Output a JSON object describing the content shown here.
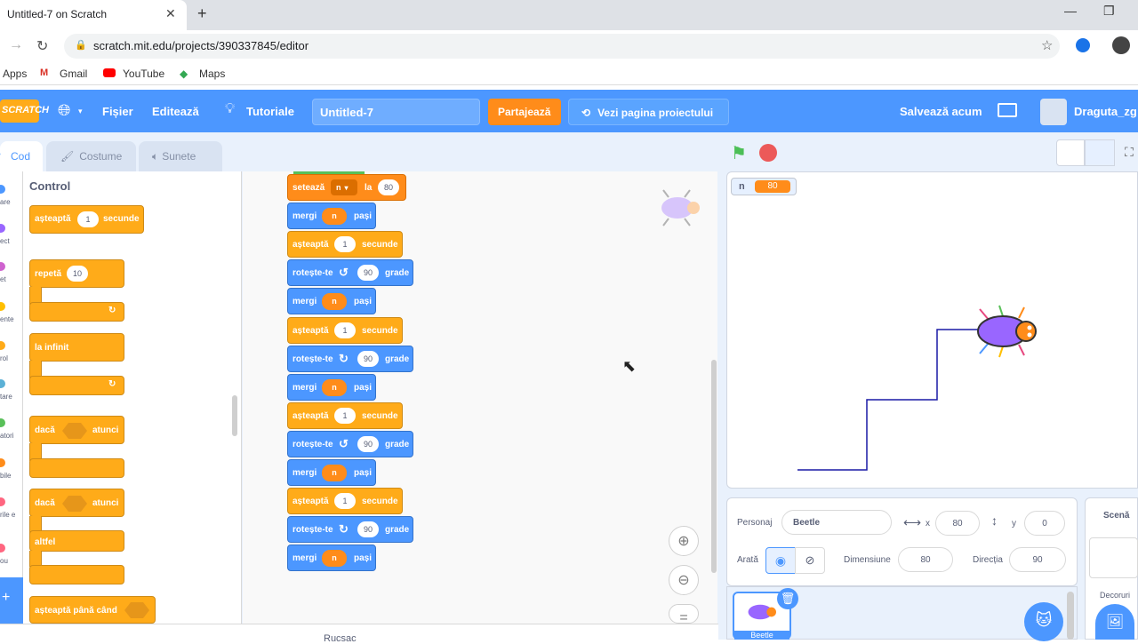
{
  "browser": {
    "tab_title": "Untitled-7 on Scratch",
    "url": "scratch.mit.edu/projects/390337845/editor",
    "bookmarks": [
      "Apps",
      "Gmail",
      "YouTube",
      "Maps"
    ]
  },
  "menu": {
    "logo": "SCRATCH",
    "file": "Fișier",
    "edit": "Editează",
    "tutorials": "Tutoriale",
    "project_title": "Untitled-7",
    "share": "Partajează",
    "see_project": "Vezi pagina proiectului",
    "save_now": "Salvează acum",
    "username": "Draguta_zg"
  },
  "tabs": {
    "code": "Cod",
    "costumes": "Costume",
    "sounds": "Sunete"
  },
  "categories": [
    {
      "label": "are",
      "color": "#4c97ff"
    },
    {
      "label": "ect",
      "color": "#9966ff"
    },
    {
      "label": "et",
      "color": "#cf63cf"
    },
    {
      "label": "ente",
      "color": "#ffbf00"
    },
    {
      "label": "rol",
      "color": "#ffab19"
    },
    {
      "label": "tare",
      "color": "#5cb1d6"
    },
    {
      "label": "atori",
      "color": "#59c059"
    },
    {
      "label": "bile",
      "color": "#ff8c1a"
    },
    {
      "label": "rile e",
      "color": "#ff6680"
    },
    {
      "label": "ou",
      "color": "#ff6680"
    }
  ],
  "palette": {
    "title": "Control",
    "wait": "așteaptă",
    "wait_val": "1",
    "seconds": "secunde",
    "repeat": "repetă",
    "repeat_val": "10",
    "forever": "la infinit",
    "if": "dacă",
    "then": "atunci",
    "else": "altfel",
    "wait_until": "așteaptă până când"
  },
  "script": {
    "set": "setează",
    "var": "n",
    "to": "la",
    "set_val": "80",
    "move": "mergi",
    "steps": "pași",
    "wait": "așteaptă",
    "wait_val": "1",
    "seconds": "secunde",
    "turn": "rotește-te",
    "turn_val": "90",
    "degrees": "grade"
  },
  "stage": {
    "monitor_label": "n",
    "monitor_value": "80"
  },
  "sprite_info": {
    "sprite_label": "Personaj",
    "sprite_name": "Beetle",
    "x_label": "x",
    "x_val": "80",
    "y_label": "y",
    "y_val": "0",
    "show_label": "Arată",
    "size_label": "Dimensiune",
    "size_val": "80",
    "direction_label": "Direcția",
    "direction_val": "90",
    "thumb_name": "Beetle"
  },
  "stage_pane": {
    "title": "Scenă",
    "backdrops": "Decoruri"
  },
  "bottom": {
    "backpack": "Rucsac"
  }
}
